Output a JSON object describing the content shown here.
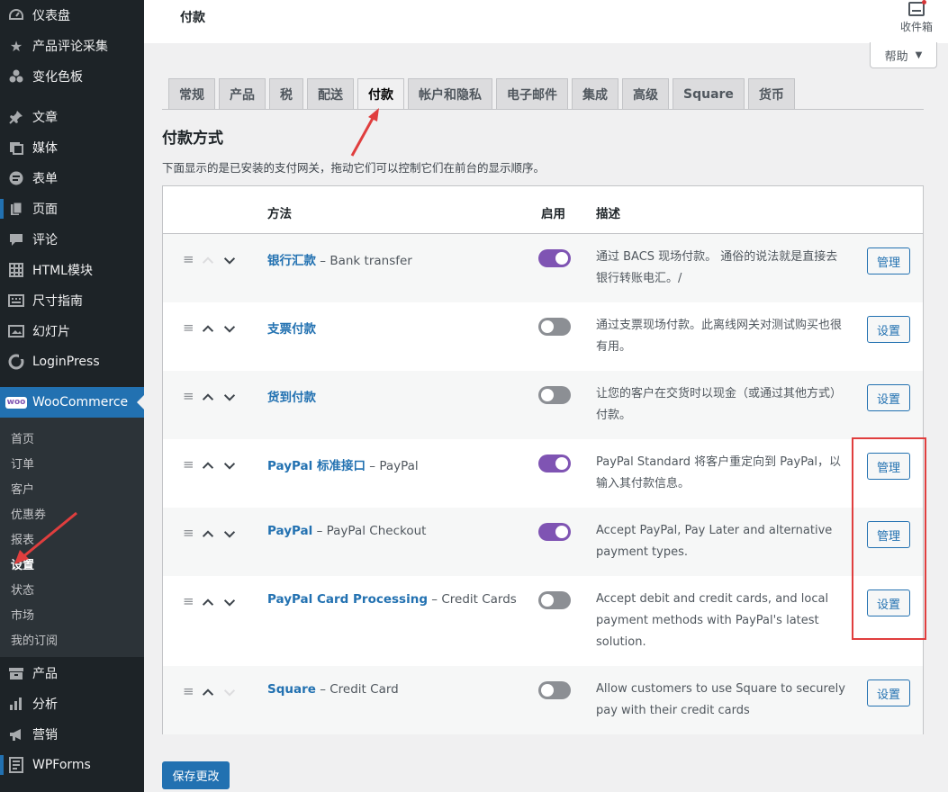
{
  "sidebar": {
    "items": [
      {
        "label": "仪表盘",
        "icon": "dashboard-icon"
      },
      {
        "label": "产品评论采集",
        "icon": "star-icon"
      },
      {
        "label": "变化色板",
        "icon": "palette-icon"
      },
      {
        "label": "文章",
        "icon": "pin-icon"
      },
      {
        "label": "媒体",
        "icon": "media-icon"
      },
      {
        "label": "表单",
        "icon": "form-icon"
      },
      {
        "label": "页面",
        "icon": "page-icon"
      },
      {
        "label": "评论",
        "icon": "comment-icon"
      },
      {
        "label": "HTML模块",
        "icon": "grid-icon"
      },
      {
        "label": "尺寸指南",
        "icon": "keyboard-icon"
      },
      {
        "label": "幻灯片",
        "icon": "slides-icon"
      },
      {
        "label": "LoginPress",
        "icon": "loginpress-icon"
      },
      {
        "label": "WooCommerce",
        "icon": "woo-icon",
        "badge": "woo"
      },
      {
        "label": "产品",
        "icon": "archive-icon"
      },
      {
        "label": "分析",
        "icon": "chart-icon"
      },
      {
        "label": "营销",
        "icon": "megaphone-icon"
      },
      {
        "label": "WPForms",
        "icon": "wpforms-icon"
      }
    ],
    "submenu": [
      "首页",
      "订单",
      "客户",
      "优惠券",
      "报表",
      "设置",
      "状态",
      "市场",
      "我的订阅"
    ]
  },
  "header": {
    "title": "付款",
    "inbox_label": "收件箱",
    "help_label": "帮助"
  },
  "tabs": [
    "常规",
    "产品",
    "税",
    "配送",
    "付款",
    "帐户和隐私",
    "电子邮件",
    "集成",
    "高级",
    "Square",
    "货币"
  ],
  "section": {
    "title": "付款方式",
    "description": "下面显示的是已安装的支付网关，拖动它们可以控制它们在前台的显示顺序。"
  },
  "table": {
    "columns": {
      "method": "方法",
      "enabled": "启用",
      "description": "描述"
    },
    "rows": [
      {
        "title": "银行汇款",
        "suffix": " – Bank transfer",
        "enabled": true,
        "desc": "通过 BACS 现场付款。 通俗的说法就是直接去银行转账电汇。/",
        "action": "管理",
        "up_enabled": false,
        "down_enabled": true
      },
      {
        "title": "支票付款",
        "suffix": "",
        "enabled": false,
        "desc": "通过支票现场付款。此离线网关对测试购买也很有用。",
        "action": "设置",
        "up_enabled": true,
        "down_enabled": true
      },
      {
        "title": "货到付款",
        "suffix": "",
        "enabled": false,
        "desc": "让您的客户在交货时以现金（或通过其他方式）付款。",
        "action": "设置",
        "up_enabled": true,
        "down_enabled": true
      },
      {
        "title": "PayPal 标准接口",
        "suffix": " – PayPal",
        "enabled": true,
        "desc": "PayPal Standard 将客户重定向到 PayPal，以输入其付款信息。",
        "action": "管理",
        "up_enabled": true,
        "down_enabled": true
      },
      {
        "title": "PayPal",
        "suffix": " – PayPal Checkout",
        "enabled": true,
        "desc": "Accept PayPal, Pay Later and alternative payment types.",
        "action": "管理",
        "up_enabled": true,
        "down_enabled": true
      },
      {
        "title": "PayPal Card Processing",
        "suffix": " – Credit Cards",
        "enabled": false,
        "desc": "Accept debit and credit cards, and local payment methods with PayPal's latest solution.",
        "action": "设置",
        "up_enabled": true,
        "down_enabled": true
      },
      {
        "title": "Square",
        "suffix": " – Credit Card",
        "enabled": false,
        "desc": "Allow customers to use Square to securely pay with their credit cards",
        "action": "设置",
        "up_enabled": true,
        "down_enabled": false
      }
    ]
  },
  "save_label": "保存更改",
  "colors": {
    "accent": "#2271b1",
    "toggle_on": "#7f54b3",
    "annotation": "#e03e3e"
  }
}
